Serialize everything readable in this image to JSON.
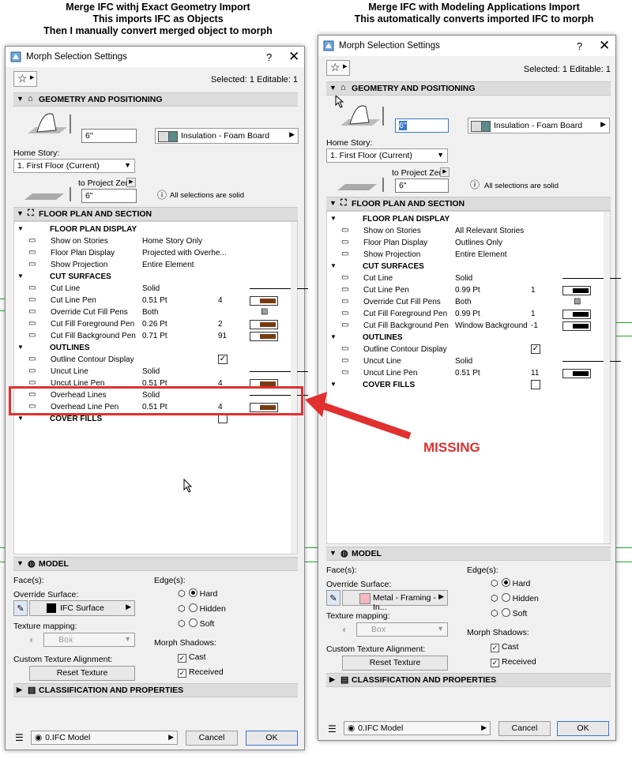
{
  "left_caption": {
    "line1": "Merge IFC withj Exact Geometry Import",
    "line2": "This imports IFC as Objects",
    "line3": "Then I manually convert merged object to morph"
  },
  "right_caption": {
    "line1": "Merge IFC with Modeling Applications Import",
    "line2": "This automatically converts imported IFC to morph"
  },
  "annotation": {
    "missing": "MISSING"
  },
  "left": {
    "title": "Morph Selection Settings",
    "help": "?",
    "close": "✕",
    "selected_info": "Selected: 1 Editable: 1",
    "sec_geometry": "GEOMETRY AND POSITIONING",
    "height_value": "6\"",
    "material": "Insulation - Foam Board",
    "home_story_label": "Home Story:",
    "home_story_value": "1. First Floor (Current)",
    "to_project_zero": "to Project Zero",
    "project_zero_value": "6\"",
    "all_selections_solid": "All selections are solid",
    "sec_floorplan": "FLOOR PLAN AND SECTION",
    "rows": [
      {
        "icon": "",
        "label": "FLOOR PLAN DISPLAY",
        "value": "",
        "num": "",
        "grp": true
      },
      {
        "icon": "",
        "label": "Show on Stories",
        "value": "Home Story Only",
        "num": "",
        "grp": false
      },
      {
        "icon": "",
        "label": "Floor Plan Display",
        "value": "Projected with Overhe...",
        "num": "",
        "grp": false
      },
      {
        "icon": "",
        "label": "Show Projection",
        "value": "Entire Element",
        "num": "",
        "grp": false
      },
      {
        "icon": "",
        "label": "CUT SURFACES",
        "value": "",
        "num": "",
        "grp": true
      },
      {
        "icon": "",
        "label": "Cut Line",
        "value": "Solid",
        "num": "",
        "grp": false
      },
      {
        "icon": "",
        "label": "Cut Line Pen",
        "value": "0.51 Pt",
        "num": "4",
        "grp": false
      },
      {
        "icon": "",
        "label": "Override Cut Fill Pens",
        "value": "Both",
        "num": "",
        "grp": false
      },
      {
        "icon": "",
        "label": "Cut Fill Foreground Pen",
        "value": "0.26 Pt",
        "num": "2",
        "grp": false
      },
      {
        "icon": "",
        "label": "Cut Fill Background Pen",
        "value": "0.71 Pt",
        "num": "91",
        "grp": false
      },
      {
        "icon": "",
        "label": "OUTLINES",
        "value": "",
        "num": "",
        "grp": true
      },
      {
        "icon": "",
        "label": "Outline Contour Display",
        "value": "",
        "num": "",
        "grp": false
      },
      {
        "icon": "",
        "label": "Uncut Line",
        "value": "Solid",
        "num": "",
        "grp": false
      },
      {
        "icon": "",
        "label": "Uncut Line Pen",
        "value": "0.51 Pt",
        "num": "4",
        "grp": false
      },
      {
        "icon": "",
        "label": "Overhead Lines",
        "value": "Solid",
        "num": "",
        "grp": false
      },
      {
        "icon": "",
        "label": "Overhead Line Pen",
        "value": "0.51 Pt",
        "num": "4",
        "grp": false
      },
      {
        "icon": "",
        "label": "COVER FILLS",
        "value": "",
        "num": "",
        "grp": true
      }
    ],
    "sec_model": "MODEL",
    "faces_label": "Face(s):",
    "override_surface_label": "Override Surface:",
    "override_surface_value": "IFC Surface",
    "texture_mapping_label": "Texture mapping:",
    "texture_mapping_value": "Box",
    "custom_texture_label": "Custom Texture Alignment:",
    "reset_texture": "Reset Texture",
    "edges_label": "Edge(s):",
    "edge_hard": "Hard",
    "edge_hidden": "Hidden",
    "edge_soft": "Soft",
    "shadows_label": "Morph Shadows:",
    "cast": "Cast",
    "received": "Received",
    "sec_classification": "CLASSIFICATION AND PROPERTIES",
    "layer": "0.IFC Model",
    "cancel": "Cancel",
    "ok": "OK"
  },
  "right": {
    "title": "Morph Selection Settings",
    "help": "?",
    "close": "✕",
    "selected_info": "Selected: 1 Editable: 1",
    "sec_geometry": "GEOMETRY AND POSITIONING",
    "height_value": "6\"",
    "material": "Insulation - Foam Board",
    "home_story_label": "Home Story:",
    "home_story_value": "1. First Floor (Current)",
    "to_project_zero": "to Project Zero",
    "project_zero_value": "6\"",
    "all_selections_solid": "All selections are solid",
    "sec_floorplan": "FLOOR PLAN AND SECTION",
    "rows": [
      {
        "label": "FLOOR PLAN DISPLAY",
        "value": "",
        "num": "",
        "grp": true
      },
      {
        "label": "Show on Stories",
        "value": "All Relevant Stories",
        "num": "",
        "grp": false
      },
      {
        "label": "Floor Plan Display",
        "value": "Outlines Only",
        "num": "",
        "grp": false
      },
      {
        "label": "Show Projection",
        "value": "Entire Element",
        "num": "",
        "grp": false
      },
      {
        "label": "CUT SURFACES",
        "value": "",
        "num": "",
        "grp": true
      },
      {
        "label": "Cut Line",
        "value": "Solid",
        "num": "",
        "grp": false
      },
      {
        "label": "Cut Line Pen",
        "value": "0.99 Pt",
        "num": "1",
        "grp": false
      },
      {
        "label": "Override Cut Fill Pens",
        "value": "Both",
        "num": "",
        "grp": false
      },
      {
        "label": "Cut Fill Foreground Pen",
        "value": "0.99 Pt",
        "num": "1",
        "grp": false
      },
      {
        "label": "Cut Fill Background Pen",
        "value": "Window Background",
        "num": "-1",
        "grp": false
      },
      {
        "label": "OUTLINES",
        "value": "",
        "num": "",
        "grp": true
      },
      {
        "label": "Outline Contour Display",
        "value": "",
        "num": "",
        "grp": false
      },
      {
        "label": "Uncut Line",
        "value": "Solid",
        "num": "",
        "grp": false
      },
      {
        "label": "Uncut Line Pen",
        "value": "0.51 Pt",
        "num": "11",
        "grp": false
      },
      {
        "label": "COVER FILLS",
        "value": "",
        "num": "",
        "grp": true
      }
    ],
    "sec_model": "MODEL",
    "faces_label": "Face(s):",
    "override_surface_label": "Override Surface:",
    "override_surface_value": "Metal - Framing - In...",
    "texture_mapping_label": "Texture mapping:",
    "texture_mapping_value": "Box",
    "custom_texture_label": "Custom Texture Alignment:",
    "reset_texture": "Reset Texture",
    "edges_label": "Edge(s):",
    "edge_hard": "Hard",
    "edge_hidden": "Hidden",
    "edge_soft": "Soft",
    "shadows_label": "Morph Shadows:",
    "cast": "Cast",
    "received": "Received",
    "sec_classification": "CLASSIFICATION AND PROPERTIES",
    "layer": "0.IFC Model",
    "cancel": "Cancel",
    "ok": "OK"
  },
  "colors": {
    "annotation_red": "#e03030",
    "pen_brown": "#7a3a10",
    "surface_pink": "#f4b8c0"
  }
}
